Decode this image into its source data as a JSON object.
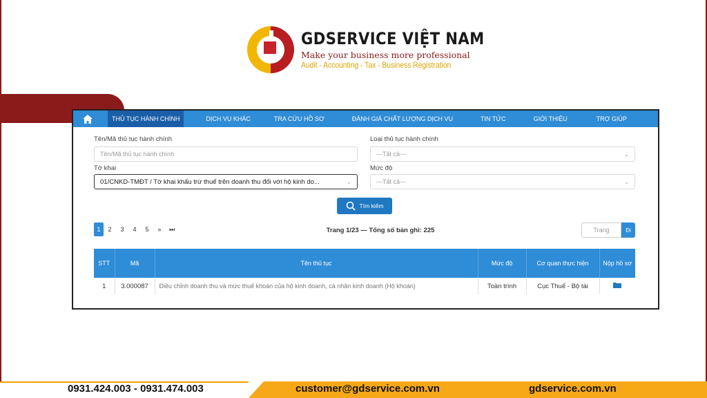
{
  "logo": {
    "brand": "GDSERVICE VIỆT NAM",
    "tagline": "Make your business more professional",
    "services": "Audit - Accounting - Tax - Business Registration"
  },
  "nav": {
    "items": [
      "THỦ TỤC HÀNH CHÍNH",
      "DỊCH VỤ KHÁC",
      "TRA CỨU HỒ SƠ",
      "ĐÁNH GIÁ CHẤT LƯỢNG DỊCH VỤ",
      "TIN TỨC",
      "GIỚI THIỆU",
      "TRỢ GIÚP"
    ]
  },
  "form": {
    "name_label": "Tên/Mã thủ tục hành chính",
    "name_placeholder": "Tên/Mã thủ tục hành chính",
    "type_label": "Loại thủ tục hành chính",
    "type_value": "---Tất cả---",
    "declaration_label": "Tờ khai",
    "declaration_value": "01/CNKD-TMĐT / Tờ khai khấu trừ thuế trên doanh thu đối với hộ kinh do...",
    "level_label": "Mức độ",
    "level_value": "---Tất cả---",
    "search_label": "Tìm kiếm"
  },
  "pagination": {
    "pages": [
      "1",
      "2",
      "3",
      "4",
      "5",
      "»",
      "⏭"
    ],
    "info": "Trang 1/23 — Tổng số bản ghi: 225",
    "page_placeholder": "Trang",
    "go_label": "Đi"
  },
  "table": {
    "headers": [
      "STT",
      "Mã",
      "Tên thủ tục",
      "Mức độ",
      "Cơ quan thực hiện",
      "Nộp hồ sơ"
    ],
    "rows": [
      [
        "1",
        "3.000087",
        "Điều chỉnh doanh thu và mức thuế khoán của hộ kinh doanh, cá nhân kinh doanh (Hộ khoán)",
        "Toàn trình",
        "Cục Thuế - Bộ tài"
      ]
    ]
  },
  "footer": {
    "phone": "0931.424.003 - 0931.474.003",
    "email": "customer@gdservice.com.vn",
    "website": "gdservice.com.vn"
  },
  "colors": {
    "brand_red": "#8b1a1a",
    "brand_gold": "#f6a817",
    "nav_blue": "#2f8cd6"
  }
}
